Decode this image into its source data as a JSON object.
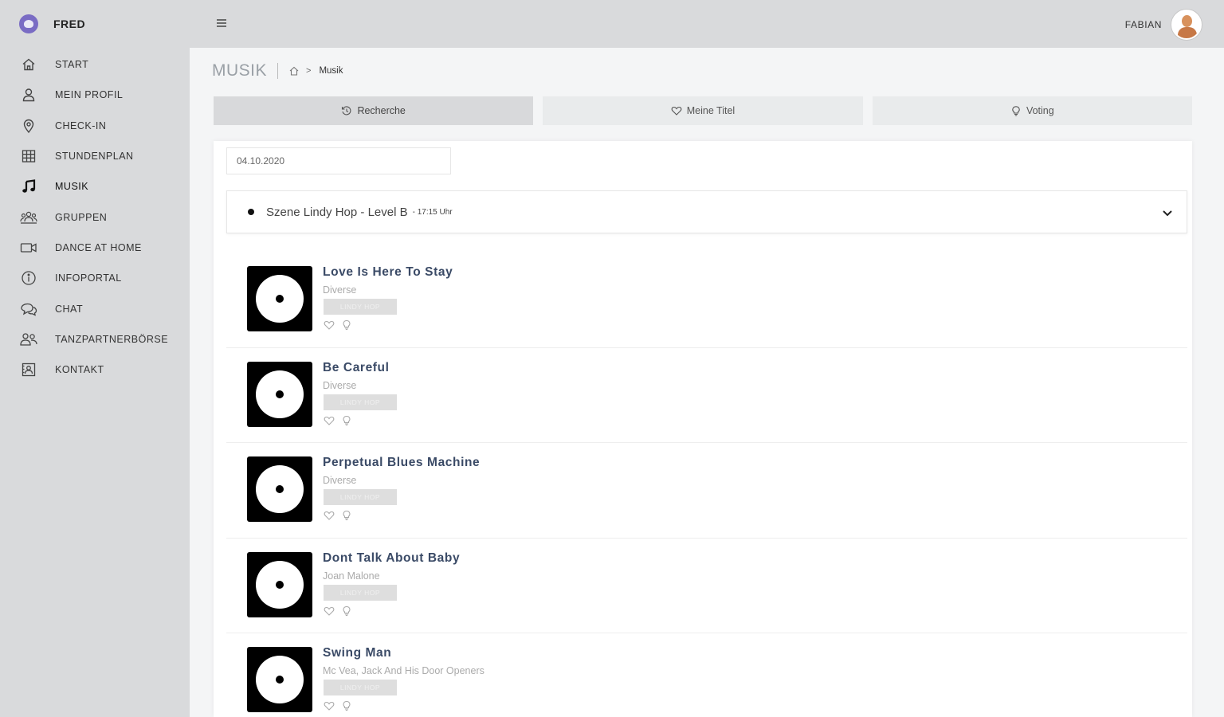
{
  "brand": {
    "name": "FRED"
  },
  "sidebar": {
    "items": [
      {
        "label": "START",
        "icon": "home-icon"
      },
      {
        "label": "MEIN PROFIL",
        "icon": "user-icon"
      },
      {
        "label": "CHECK-IN",
        "icon": "map-pin-icon"
      },
      {
        "label": "STUNDENPLAN",
        "icon": "grid-icon"
      },
      {
        "label": "MUSIK",
        "icon": "music-note-icon",
        "active": true
      },
      {
        "label": "GRUPPEN",
        "icon": "group-icon"
      },
      {
        "label": "DANCE AT HOME",
        "icon": "video-camera-icon"
      },
      {
        "label": "INFOPORTAL",
        "icon": "info-icon"
      },
      {
        "label": "CHAT",
        "icon": "chat-icon"
      },
      {
        "label": "TANZPARTNERBÖRSE",
        "icon": "partners-icon"
      },
      {
        "label": "KONTAKT",
        "icon": "contact-card-icon"
      }
    ]
  },
  "topbar": {
    "user_name": "FABIAN"
  },
  "page": {
    "title": "MUSIK",
    "breadcrumb_current": "Musik"
  },
  "tabs": [
    {
      "label": "Recherche",
      "icon": "history-icon",
      "active": true
    },
    {
      "label": "Meine Titel",
      "icon": "heart-icon",
      "active": false
    },
    {
      "label": "Voting",
      "icon": "lightbulb-icon",
      "active": false
    }
  ],
  "filters": {
    "date": "04.10.2020",
    "course_name": "Szene Lindy Hop - Level B",
    "course_time": "- 17:15 Uhr"
  },
  "songs": [
    {
      "title": "Love Is Here To Stay",
      "artist": "Diverse",
      "tag": "LINDY HOP"
    },
    {
      "title": "Be Careful",
      "artist": "Diverse",
      "tag": "LINDY HOP"
    },
    {
      "title": "Perpetual Blues Machine",
      "artist": "Diverse",
      "tag": "LINDY HOP"
    },
    {
      "title": "Dont Talk About Baby",
      "artist": "Joan Malone",
      "tag": "LINDY HOP"
    },
    {
      "title": "Swing Man",
      "artist": "Mc Vea, Jack And His Door Openers",
      "tag": "LINDY HOP"
    }
  ],
  "colors": {
    "sidebar_bg": "#d9dadc",
    "song_title": "#3a4a66",
    "brand_logo": "#7a6cc4"
  }
}
